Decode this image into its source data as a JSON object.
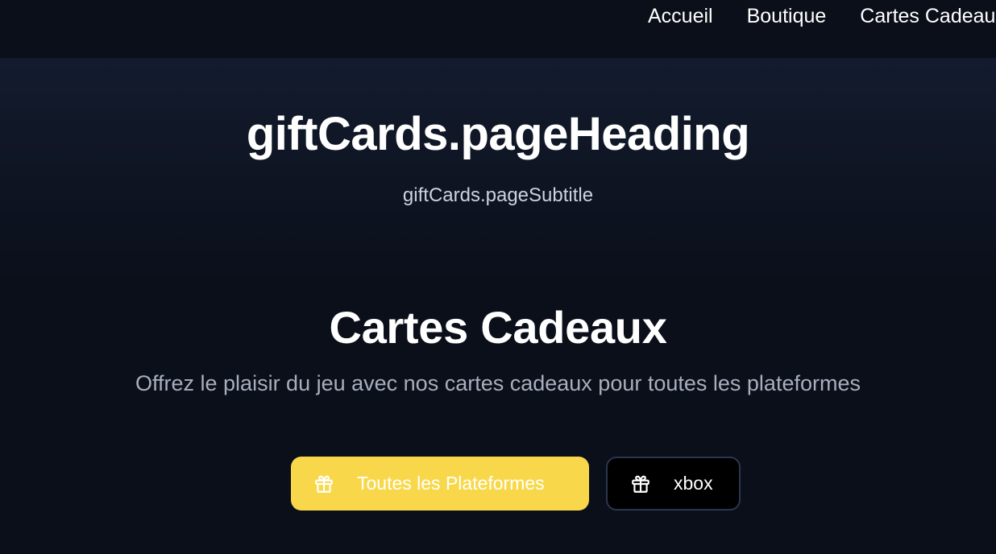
{
  "nav": {
    "items": [
      {
        "label": "Accueil"
      },
      {
        "label": "Boutique"
      },
      {
        "label": "Cartes Cadeaux"
      }
    ]
  },
  "header": {
    "heading": "giftCards.pageHeading",
    "subtitle": "giftCards.pageSubtitle"
  },
  "section": {
    "title": "Cartes Cadeaux",
    "subtitle": "Offrez le plaisir du jeu avec nos cartes cadeaux pour toutes les plateformes"
  },
  "filters": [
    {
      "label": "Toutes les Plateformes",
      "icon": "gift-icon",
      "active": true
    },
    {
      "label": "xbox",
      "icon": "gift-icon",
      "active": false
    }
  ],
  "colors": {
    "background": "#0b0f1a",
    "accent": "#f8d84a",
    "inactive_border": "#2a3650"
  }
}
